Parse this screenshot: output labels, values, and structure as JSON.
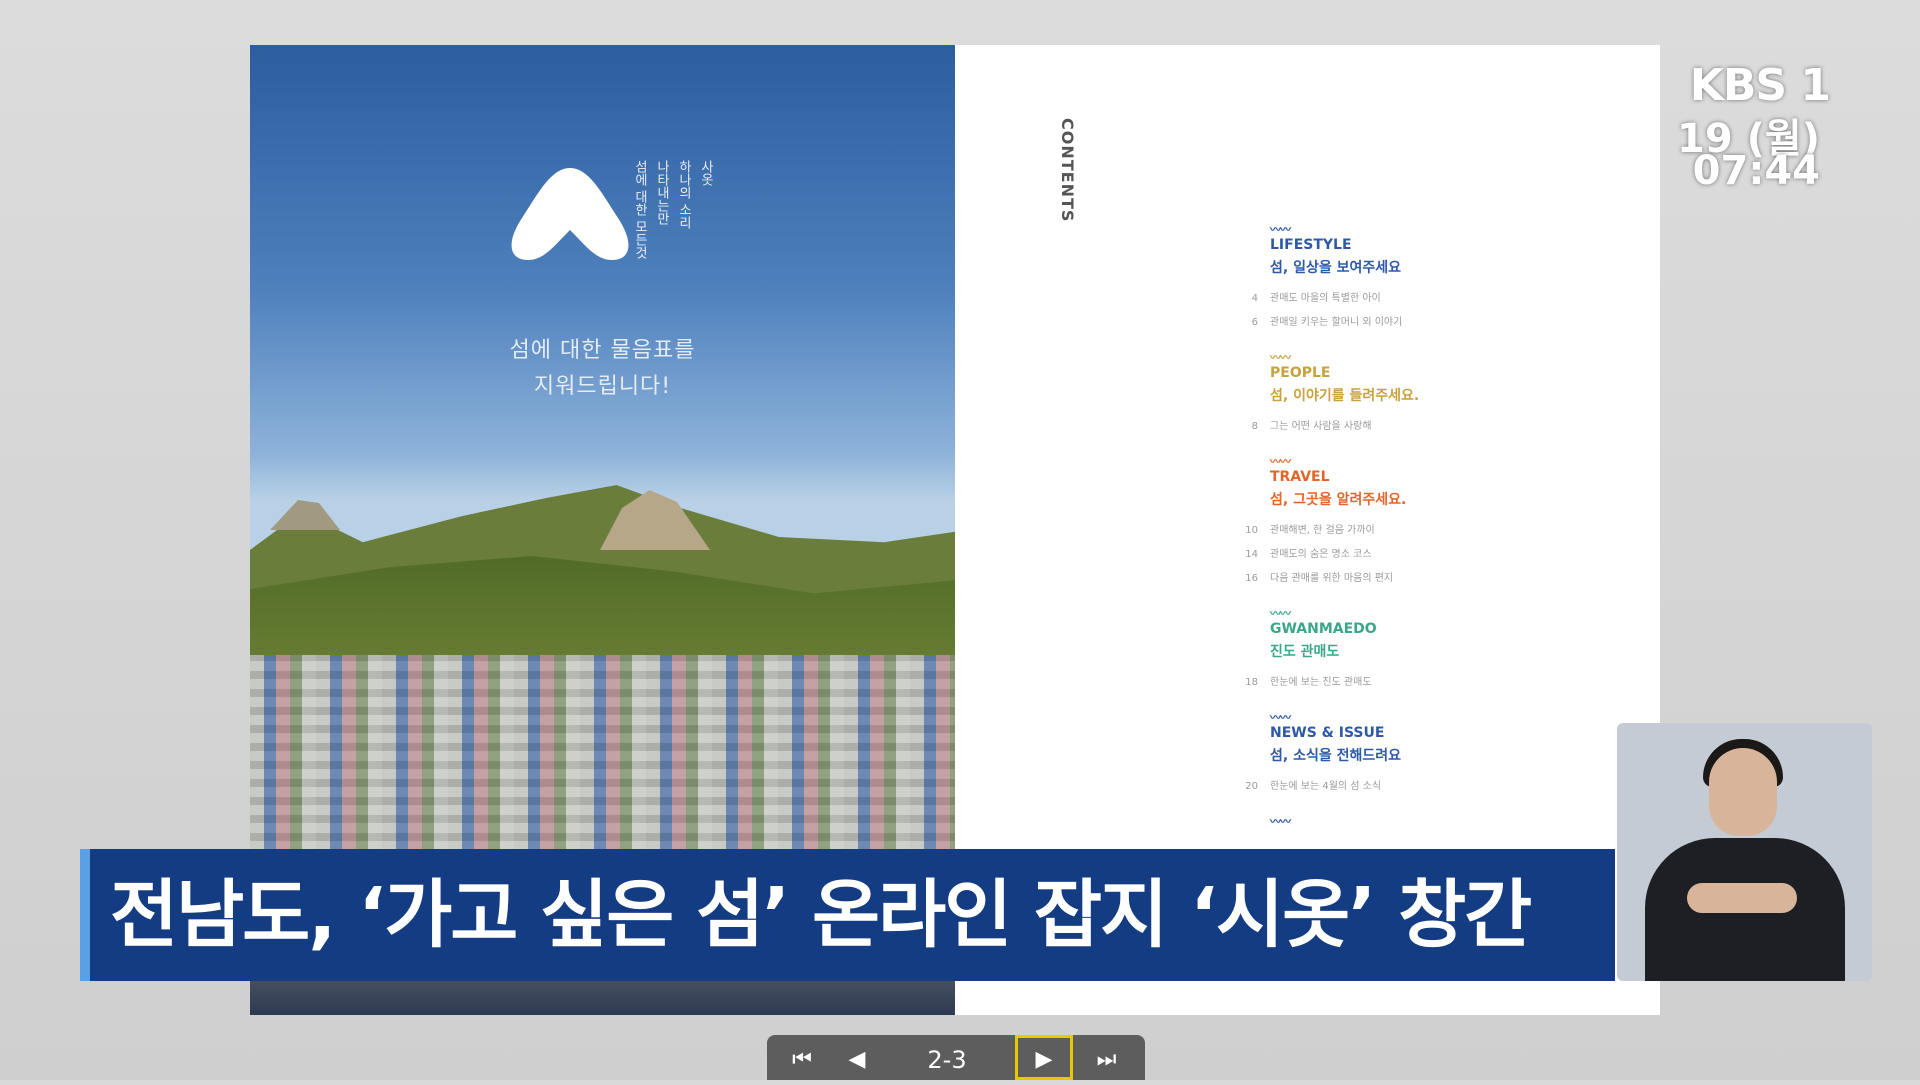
{
  "magazine": {
    "cover": {
      "tagline_lines": [
        "섬에 대한 모든것",
        "나타내는만",
        "하나의 소리",
        "사옷"
      ],
      "headline_lines": [
        "섬에 대한 물음표를",
        "지워드립니다!"
      ]
    },
    "contents": {
      "title": "CONTENTS",
      "sections": [
        {
          "wave": "〰〰",
          "en": "LIFESTYLE",
          "ko": "섬, 일상을 보여주세요",
          "color": "#2d5aa8",
          "entries": [
            {
              "page": "4",
              "text": "관매도 마을의 특별한 아이"
            },
            {
              "page": "6",
              "text": "관매일 키우는 할머니 외 이야기"
            }
          ]
        },
        {
          "wave": "〰〰",
          "en": "PEOPLE",
          "ko": "섬, 이야기를 들려주세요.",
          "color": "#c7a23e",
          "entries": [
            {
              "page": "8",
              "text": "그는 어떤 사람을 사랑해"
            }
          ]
        },
        {
          "wave": "〰〰",
          "en": "TRAVEL",
          "ko": "섬, 그곳을 알려주세요.",
          "color": "#e2662a",
          "entries": [
            {
              "page": "10",
              "text": "관매해변, 한 걸음 가까이"
            },
            {
              "page": "14",
              "text": "관매도의 숨은 명소 코스"
            },
            {
              "page": "16",
              "text": "다음 관매를 위한 마음의 편지"
            }
          ]
        },
        {
          "wave": "〰〰",
          "en": "GWANMAEDO",
          "ko": "진도 관매도",
          "color": "#3aa68a",
          "entries": [
            {
              "page": "18",
              "text": "한눈에 보는 진도 관매도"
            }
          ]
        },
        {
          "wave": "〰〰",
          "en": "NEWS & ISSUE",
          "ko": "섬, 소식을 전해드려요",
          "color": "#2d5aa8",
          "entries": [
            {
              "page": "20",
              "text": "한눈에 보는 4월의 섬 소식"
            }
          ]
        }
      ],
      "trailing_wave": "〰〰"
    }
  },
  "caption": {
    "text": "전남도, ‘가고 싶은 섬’ 온라인 잡지 ‘시옷’ 창간"
  },
  "broadcast": {
    "logo": "KBS 1",
    "date": "19 (월)",
    "time": "07:44"
  },
  "pager": {
    "first_icon": "first-page-icon",
    "prev_icon": "prev-page-icon",
    "page_label": "2-3",
    "next_icon": "next-page-icon",
    "last_icon": "last-page-icon",
    "highlight_color": "#e8c800"
  }
}
